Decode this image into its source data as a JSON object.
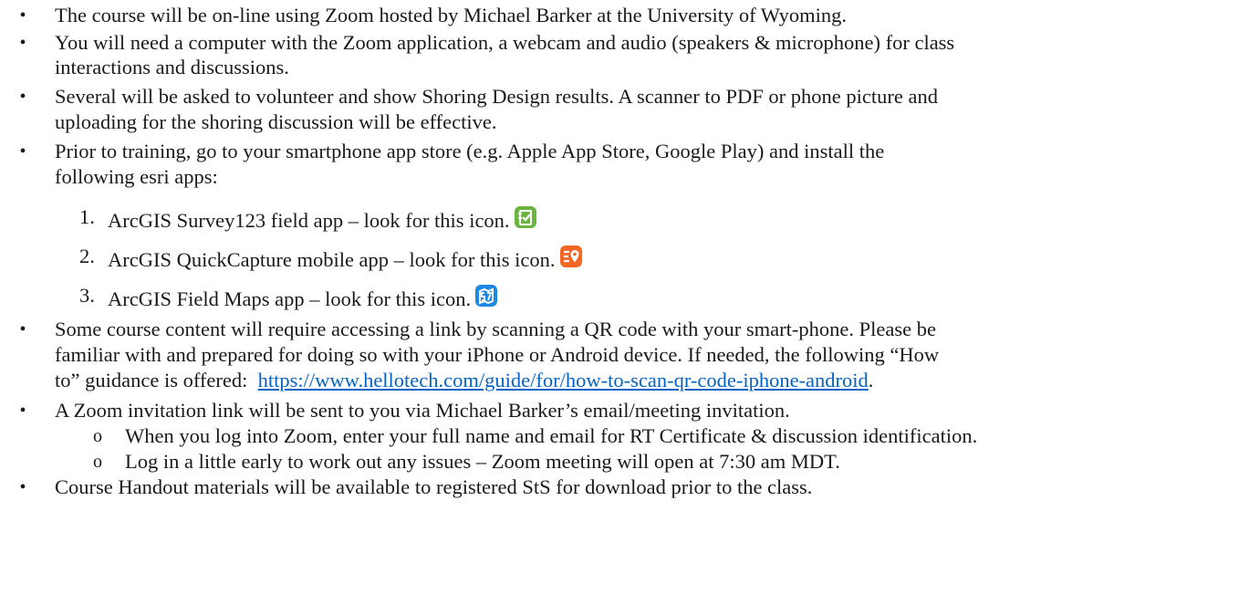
{
  "bullets": [
    {
      "text": "The course will be on-line using Zoom hosted by Michael Barker at the University of Wyoming."
    },
    {
      "line1": "You will need a computer with the Zoom application, a webcam and audio (speakers & microphone) for class",
      "line2": "interactions and discussions."
    },
    {
      "line1": "Several will be asked to volunteer and show Shoring Design results. A scanner to PDF or phone picture and",
      "line2": "uploading for the shoring discussion will be effective."
    },
    {
      "line1": "Prior to training, go to your smartphone app store (e.g. Apple App Store, Google Play) and install the",
      "line2": "following esri apps:"
    }
  ],
  "apps": [
    {
      "num": "1.",
      "text": "ArcGIS Survey123 field app – look for this icon.",
      "icon": "survey123-icon",
      "color": "#6cb33f"
    },
    {
      "num": "2.",
      "text": "ArcGIS QuickCapture mobile app – look for this icon.",
      "icon": "quickcapture-icon",
      "color": "#f26722"
    },
    {
      "num": "3.",
      "text": "ArcGIS Field Maps app – look for this icon.",
      "icon": "field-maps-icon",
      "color": "#1e88e5"
    }
  ],
  "qr": {
    "line1": "Some course content will require accessing a link by scanning a QR code with your smart-phone. Please be",
    "line2": "familiar with and prepared for doing so with your iPhone or Android device. If needed, the following “How",
    "line3_prefix": "to” guidance is offered:",
    "link": "https://www.hellotech.com/guide/for/how-to-scan-qr-code-iphone-android",
    "line3_suffix": "."
  },
  "zoom": {
    "text": "A Zoom invitation link will be sent to you via Michael Barker’s email/meeting invitation.",
    "sub": [
      "When you log into Zoom, enter your full name and email for RT Certificate & discussion identification.",
      "Log in a little early to work out any issues – Zoom meeting will open at 7:30 am MDT."
    ]
  },
  "handout": "Course Handout materials will be available to registered StS for download prior to the class.",
  "symbols": {
    "bullet": "•",
    "sub_bullet": "o"
  },
  "link_color": "#0563c1"
}
